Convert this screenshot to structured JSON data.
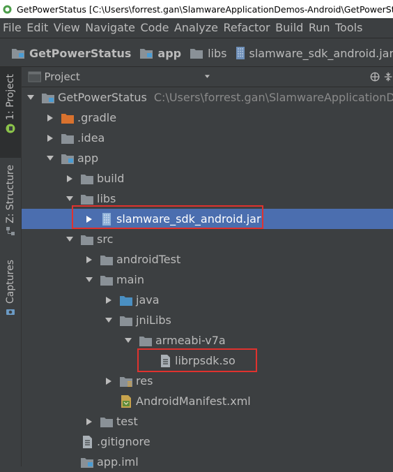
{
  "window": {
    "title": "GetPowerStatus [C:\\Users\\forrest.gan\\SlamwareApplicationDemos-Android\\GetPowerStatus]"
  },
  "menu": [
    "File",
    "Edit",
    "View",
    "Navigate",
    "Code",
    "Analyze",
    "Refactor",
    "Build",
    "Run",
    "Tools"
  ],
  "breadcrumb": [
    "GetPowerStatus",
    "app",
    "libs",
    "slamware_sdk_android.jar"
  ],
  "sidebar": {
    "project_tab": "1: Project",
    "structure_tab": "Z: Structure",
    "captures_tab": "Captures"
  },
  "panel": {
    "title": "Project"
  },
  "tree": [
    {
      "label": "GetPowerStatus",
      "path": "C:\\Users\\forrest.gan\\SlamwareApplicationDe",
      "expanded": true,
      "icon": "module-folder-icon"
    },
    {
      "label": ".gradle",
      "expanded": false,
      "icon": "orange-folder-icon"
    },
    {
      "label": ".idea",
      "expanded": false,
      "icon": "folder-icon"
    },
    {
      "label": "app",
      "expanded": true,
      "icon": "module-folder-icon"
    },
    {
      "label": "build",
      "expanded": false,
      "icon": "folder-icon"
    },
    {
      "label": "libs",
      "expanded": true,
      "icon": "folder-icon"
    },
    {
      "label": "slamware_sdk_android.jar",
      "expanded": false,
      "icon": "jar-icon",
      "selected": true
    },
    {
      "label": "src",
      "expanded": true,
      "icon": "folder-icon"
    },
    {
      "label": "androidTest",
      "expanded": false,
      "icon": "folder-icon"
    },
    {
      "label": "main",
      "expanded": true,
      "icon": "folder-icon"
    },
    {
      "label": "java",
      "expanded": false,
      "icon": "blue-folder-icon"
    },
    {
      "label": "jniLibs",
      "expanded": true,
      "icon": "folder-icon"
    },
    {
      "label": "armeabi-v7a",
      "expanded": true,
      "icon": "folder-icon"
    },
    {
      "label": "librpsdk.so",
      "icon": "file-icon"
    },
    {
      "label": "res",
      "expanded": false,
      "icon": "res-folder-icon"
    },
    {
      "label": "AndroidManifest.xml",
      "icon": "manifest-icon"
    },
    {
      "label": "test",
      "expanded": false,
      "icon": "folder-icon"
    },
    {
      "label": ".gitignore",
      "icon": "file-icon"
    },
    {
      "label": "app.iml",
      "icon": "module-file-icon"
    }
  ],
  "colors": {
    "background": "#3c3f41",
    "selection": "#4b6eaf",
    "text": "#bbbbbb",
    "highlight_box": "#e0322e"
  }
}
